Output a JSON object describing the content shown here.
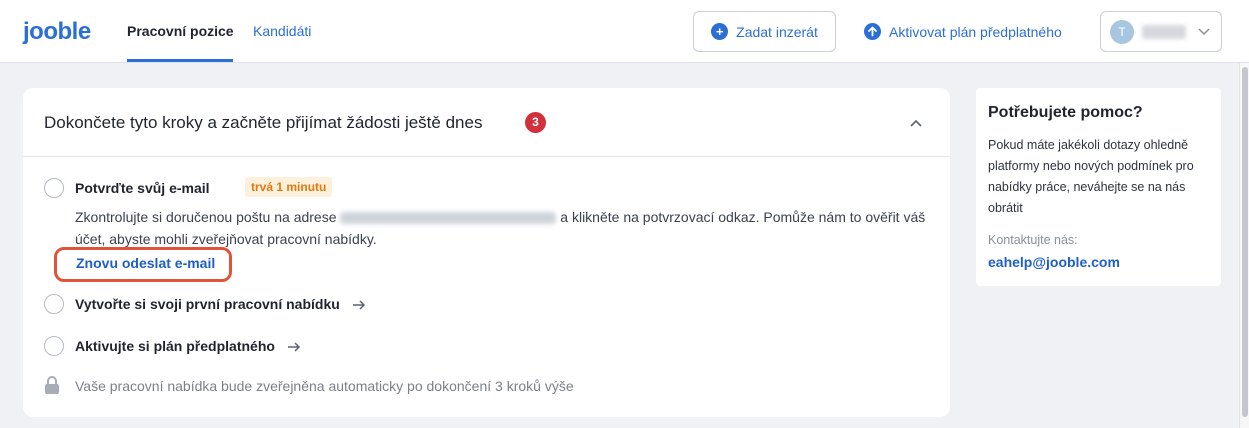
{
  "header": {
    "logo": "jooble",
    "tabs": [
      {
        "label": "Pracovní pozice",
        "active": true
      },
      {
        "label": "Kandidáti",
        "active": false
      }
    ],
    "post_button": "Zadat inzerát",
    "activate_link": "Aktivovat plán předplatného",
    "user_initial": "T"
  },
  "steps_card": {
    "title": "Dokončete tyto kroky a začněte přijímat žádosti ještě dnes",
    "badge_count": "3",
    "steps": [
      {
        "title": "Potvrďte svůj e-mail",
        "tag": "trvá 1 minutu",
        "desc_before": "Zkontrolujte si doručenou poštu na adrese",
        "desc_after": "a klikněte na potvrzovací odkaz. Pomůže nám to ověřit váš účet, abyste mohli zveřejňovat pracovní nabídky.",
        "action": "Znovu odeslat e-mail"
      },
      {
        "title": "Vytvořte si svoji první pracovní nabídku"
      },
      {
        "title": "Aktivujte si plán předplatného"
      }
    ],
    "footer_note": "Vaše pracovní nabídka bude zveřejněna automaticky po dokončení 3 kroků výše"
  },
  "help": {
    "title": "Potřebujete pomoc?",
    "body": "Pokud máte jakékoli dotazy ohledně platformy nebo nových podmínek pro nabídky práce, neváhejte se na nás obrátit",
    "contact_label": "Kontaktujte nás:",
    "email": "eahelp@jooble.com"
  },
  "colors": {
    "accent": "#2b6fd6",
    "badge": "#d2303b",
    "highlight": "#e0553a",
    "tag_bg": "#fdf0dc",
    "tag_text": "#e07a10"
  }
}
